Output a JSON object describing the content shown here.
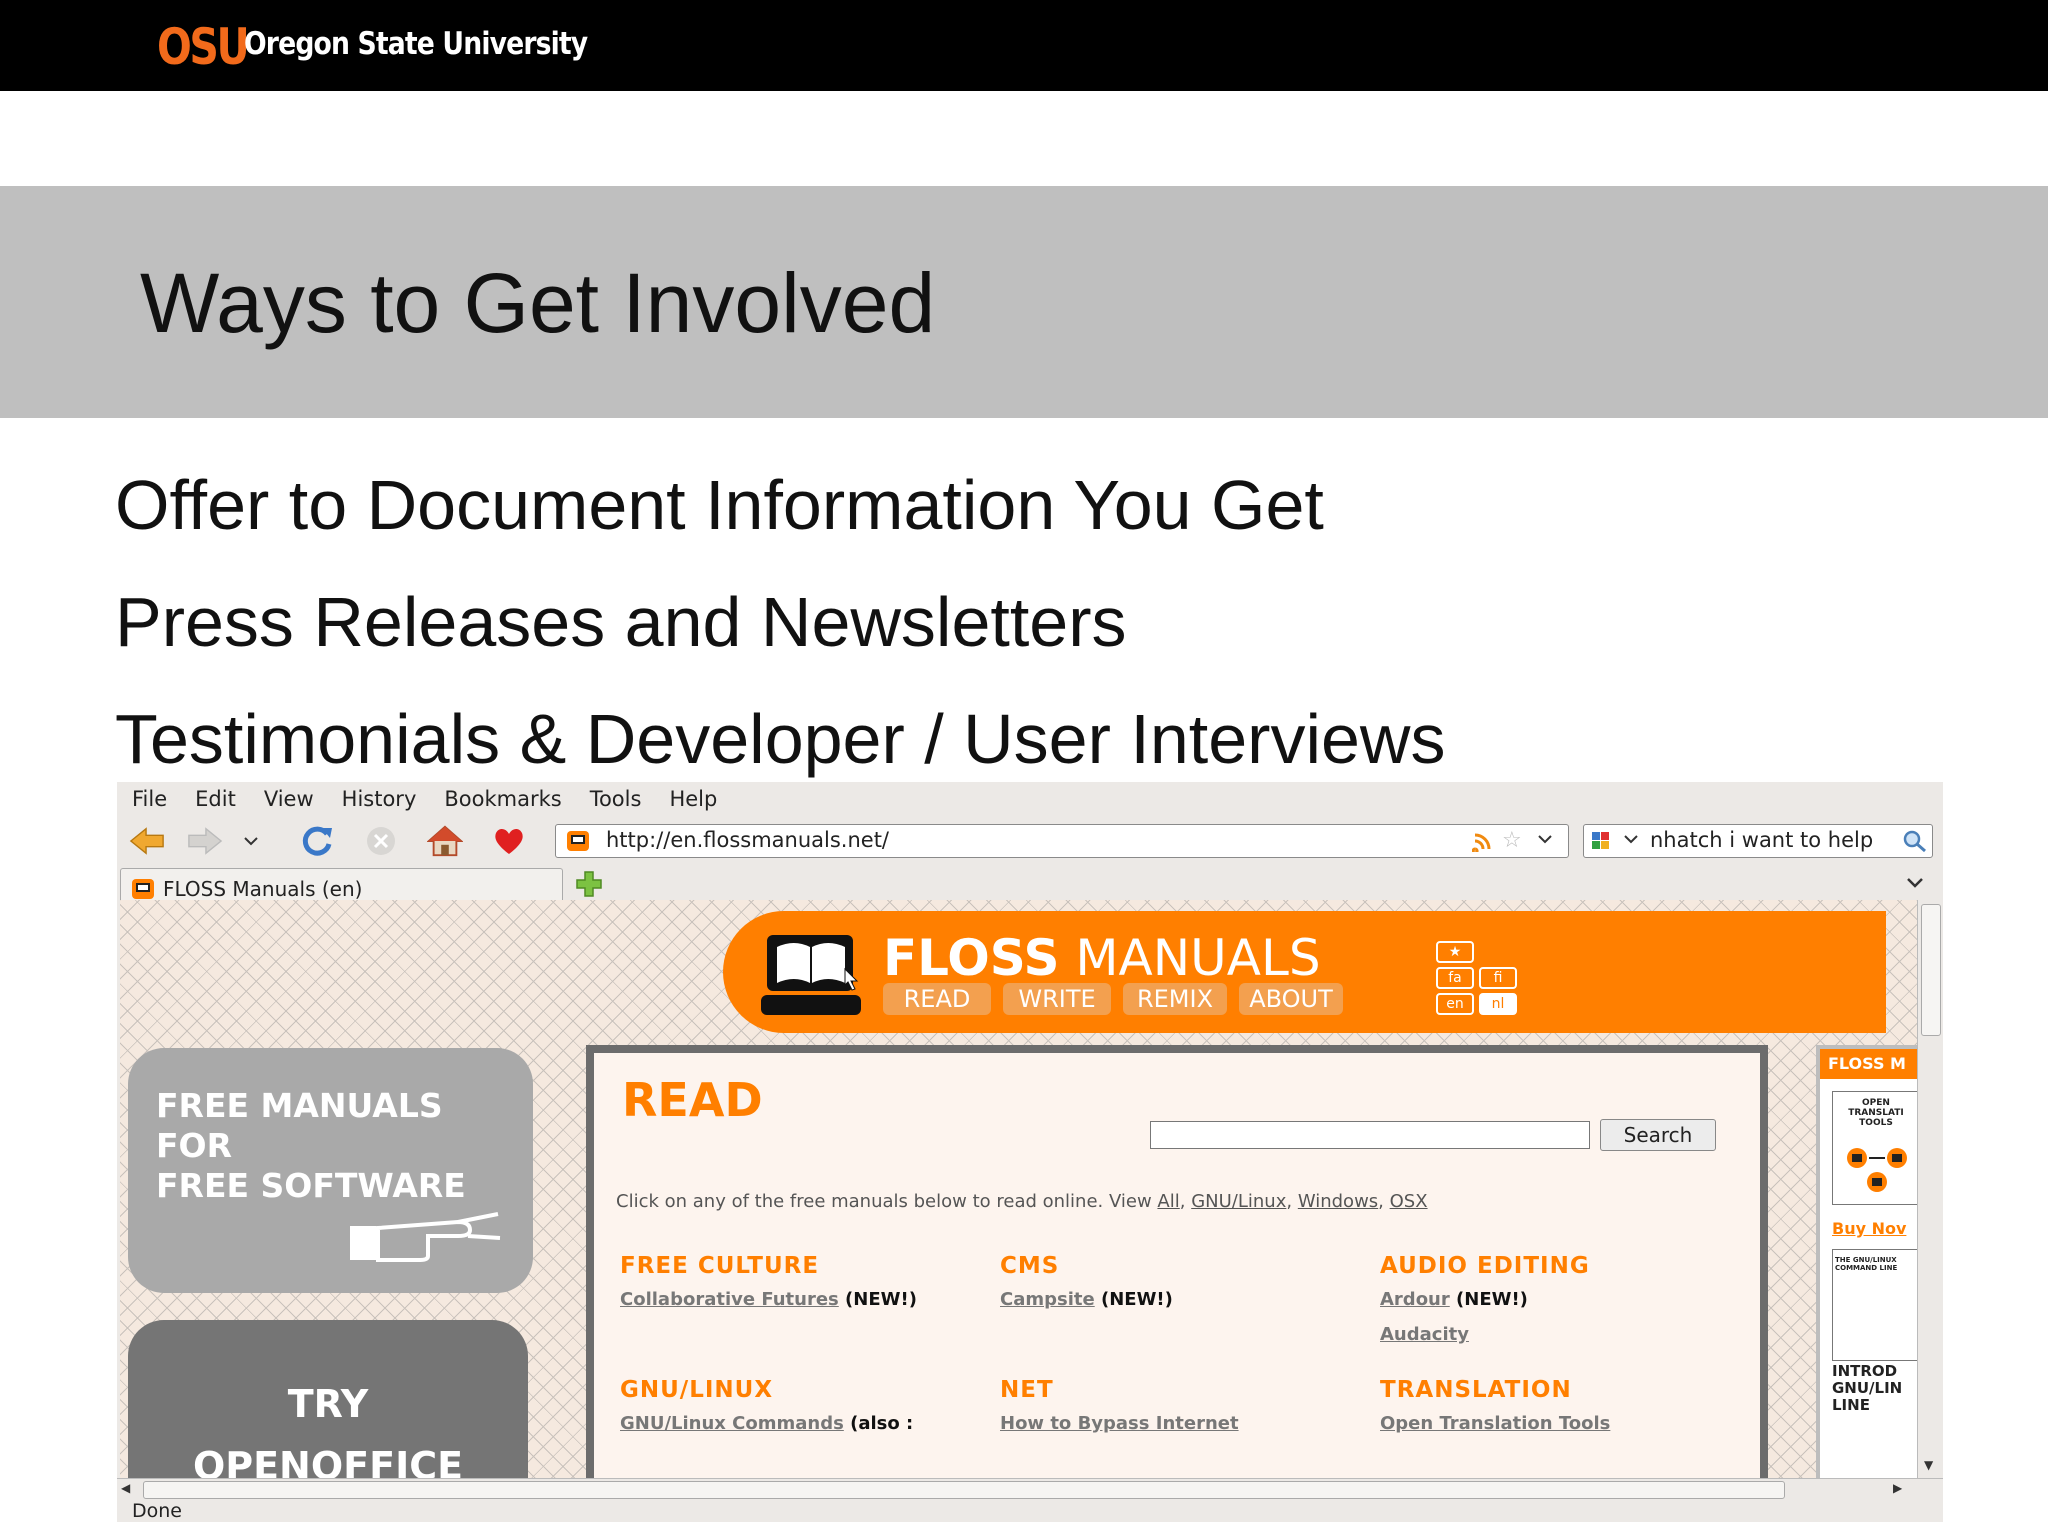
{
  "header": {
    "logo_mark": "OSU",
    "university": "Oregon State University"
  },
  "slide": {
    "title": "Ways to Get Involved",
    "bullets": [
      "Offer to Document Information You Get",
      "Press Releases and Newsletters",
      "Testimonials & Developer / User Interviews"
    ]
  },
  "browser": {
    "menu": [
      "File",
      "Edit",
      "View",
      "History",
      "Bookmarks",
      "Tools",
      "Help"
    ],
    "url": "http://en.flossmanuals.net/",
    "search_value": "nhatch i want to help",
    "tab_label": "FLOSS Manuals (en)",
    "status": "Done",
    "icons": {
      "back": "back-arrow-icon",
      "forward": "forward-arrow-icon",
      "reload": "reload-icon",
      "stop": "stop-icon",
      "home": "home-icon",
      "bookmark": "heart-icon"
    }
  },
  "site": {
    "brand_bold": "FLOSS",
    "brand_rest": " MANUALS",
    "nav": [
      "READ",
      "WRITE",
      "REMIX",
      "ABOUT"
    ],
    "langs": [
      "★",
      "fa",
      "fi",
      "en",
      "nl"
    ],
    "promo1": "FREE MANUALS\nFOR\nFREE SOFTWARE",
    "promo2": "TRY",
    "promo2_cut": "OPENOFFICE",
    "read_title": "READ",
    "search_button": "Search",
    "intro_prefix": "Click on any of the free manuals below to read online. View ",
    "intro_links": [
      "All",
      "GNU/Linux",
      "Windows",
      "OSX"
    ],
    "categories": [
      {
        "name": "FREE CULTURE",
        "items": [
          {
            "link": "Collaborative Futures",
            "tag": "(NEW!)"
          }
        ]
      },
      {
        "name": "CMS",
        "items": [
          {
            "link": "Campsite",
            "tag": "(NEW!)"
          }
        ]
      },
      {
        "name": "AUDIO EDITING",
        "items": [
          {
            "link": "Ardour",
            "tag": "(NEW!)"
          },
          {
            "link": "Audacity",
            "tag": ""
          }
        ]
      },
      {
        "name": "GNU/LINUX",
        "items": [
          {
            "link": "GNU/Linux Commands",
            "tag": "(also :"
          }
        ]
      },
      {
        "name": "NET",
        "items": [
          {
            "link": "How to Bypass Internet",
            "tag": ""
          }
        ]
      },
      {
        "name": "TRANSLATION",
        "items": [
          {
            "link": "Open Translation Tools",
            "tag": ""
          }
        ]
      }
    ],
    "right": {
      "title": "FLOSS M",
      "box1": "OPEN\nTRANSLATI\nTOOLS",
      "buy": "Buy Nov",
      "box2": "THE GNU/LINUX\nCOMMAND LINE",
      "intro": "INTROD\nGNU/LIN\nLINE"
    }
  },
  "colors": {
    "osu_orange": "#f26a1b",
    "floss_orange": "#ff7f00",
    "title_band": "#bfbfbf"
  }
}
